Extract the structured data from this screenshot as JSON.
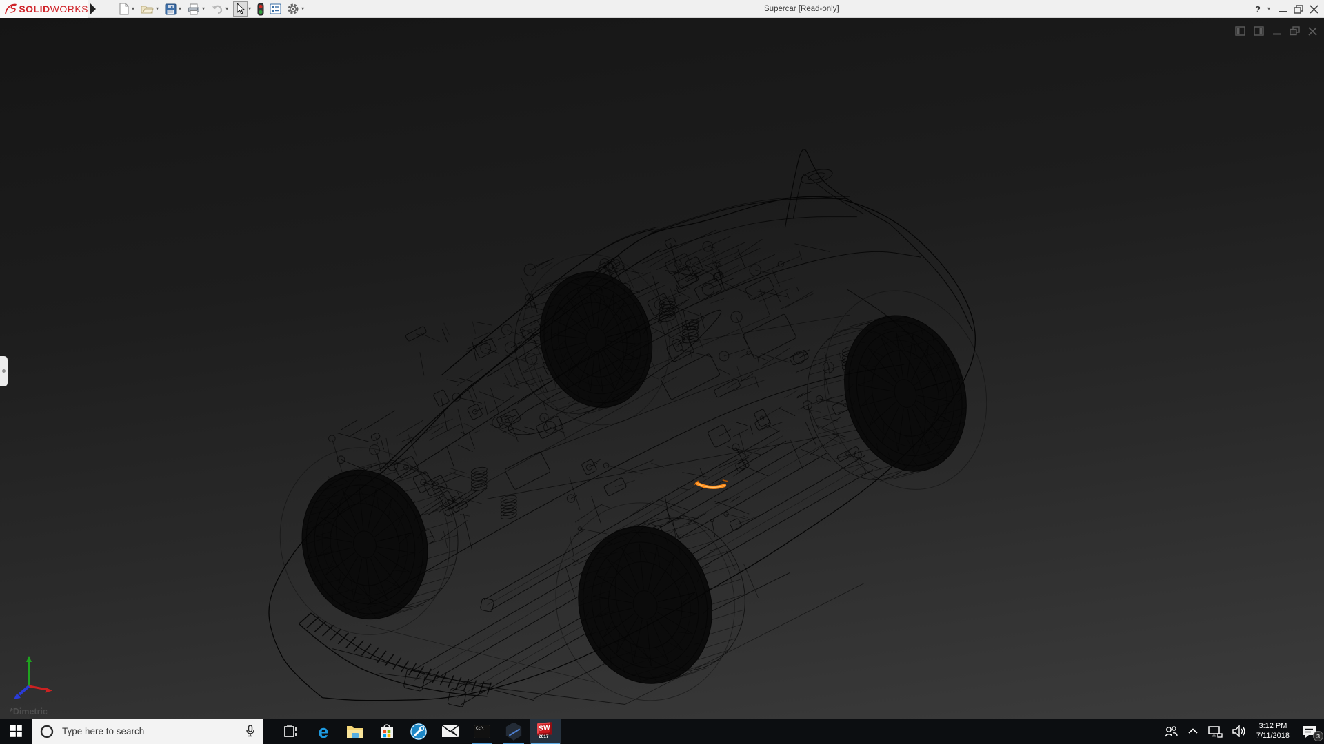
{
  "titlebar": {
    "brand": {
      "bold": "SOLID",
      "light": "WORKS"
    },
    "menu_expand": "toolbar-expand-arrow",
    "title": "Supercar [Read-only]",
    "help_label": "?",
    "caret": "▾",
    "toolbar_icons": [
      "new-document",
      "open",
      "save",
      "print",
      "undo",
      "select",
      "rebuild-stoplight",
      "file-properties",
      "options"
    ]
  },
  "viewport": {
    "view_orientation_label": "*Dimetric",
    "selected_edge_color": "#ff8c1a",
    "triad": {
      "x_color": "#cc2222",
      "y_color": "#1fa41f",
      "z_color": "#2a3bd6"
    },
    "doc_window_icons": [
      "show-featuremanager-pane",
      "show-second-pane",
      "minimize-document",
      "restore-document",
      "close-document"
    ]
  },
  "taskbar": {
    "search_placeholder": "Type here to search",
    "edge_glyph": "e",
    "cmd_label": "C:\\_",
    "sw_label": "SW",
    "sw_year": "2017",
    "icons": [
      "start",
      "cortana-search",
      "task-view",
      "edge",
      "file-explorer",
      "store",
      "support-tool",
      "mail",
      "command-prompt",
      "cad-tool",
      "solidworks-2017"
    ],
    "tray": {
      "icons": [
        "people",
        "hidden-icons-chevron",
        "network",
        "volume",
        "clock",
        "action-center"
      ],
      "time": "3:12 PM",
      "date": "7/11/2018",
      "notification_count": "3"
    }
  },
  "colors": {
    "titlebar_bg": "#f0f0f0",
    "viewport_top": "#151515",
    "viewport_bottom": "#3c3c3c",
    "taskbar_bg": "#0c0e11",
    "running_underline": "#4e9ad4",
    "solidworks_red": "#cf2329",
    "selection_orange": "#ff8c1a",
    "wireframe_line": "#000000"
  }
}
